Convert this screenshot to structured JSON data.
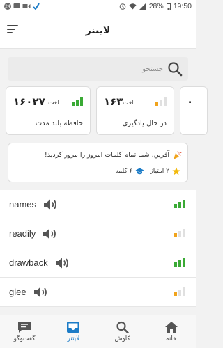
{
  "status_bar": {
    "notification_count": "24",
    "battery": "28%",
    "time": "19:50",
    "icons": [
      "message-icon",
      "video-icon",
      "check-icon",
      "alarm-icon",
      "wifi-icon",
      "signal-icon",
      "battery-icon"
    ]
  },
  "app_bar": {
    "title": "لایتنر",
    "menu_icon": "sort-menu-icon"
  },
  "search": {
    "placeholder": "جستجو",
    "icon": "search-icon"
  },
  "stats": [
    {
      "value": "۱۶۰۲۷",
      "unit": "لغت",
      "label": "حافظه بلند مدت",
      "level": 3,
      "color": "#3aaa35"
    },
    {
      "value": "۱۶۳",
      "unit": "لغت",
      "label": "در حال یادگیری",
      "level": 1,
      "color": "#f0a31c"
    },
    {
      "value": "۰",
      "unit": "",
      "label": "",
      "level": 0,
      "color": "#e0e0e0"
    }
  ],
  "notice": {
    "message": "آفرین، شما تمام کلمات امروز را مرور کردید!",
    "points": "۲ امتیاز",
    "words": "۶ کلمه",
    "icon": "party-popper-icon",
    "star_color": "#f2b90c",
    "cap_color": "#1c7cc7"
  },
  "words": [
    {
      "word": "names",
      "level": 3,
      "color": "#3aaa35"
    },
    {
      "word": "readily",
      "level": 1,
      "color": "#f0a31c"
    },
    {
      "word": "drawback",
      "level": 3,
      "color": "#3aaa35"
    },
    {
      "word": "glee",
      "level": 1,
      "color": "#f0a31c"
    }
  ],
  "bottom_nav": [
    {
      "label": "خانه",
      "icon": "home-icon",
      "active": false
    },
    {
      "label": "کاوش",
      "icon": "search-icon",
      "active": false
    },
    {
      "label": "لایتنر",
      "icon": "inbox-icon",
      "active": true
    },
    {
      "label": "گفت‌وگو",
      "icon": "chat-icon",
      "active": false
    }
  ],
  "colors": {
    "accent": "#1c7cc7",
    "green": "#3aaa35",
    "orange": "#f0a31c"
  }
}
